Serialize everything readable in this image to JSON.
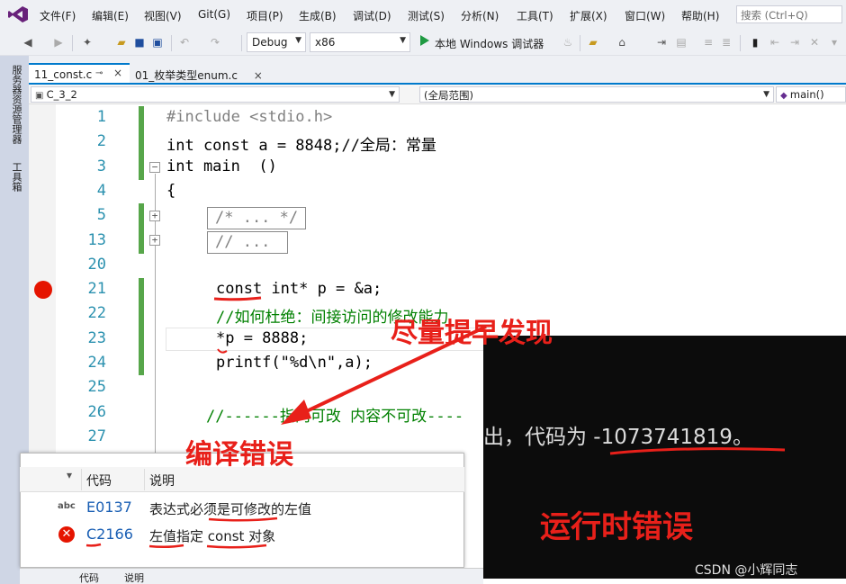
{
  "menu": {
    "items": [
      "文件(F)",
      "编辑(E)",
      "视图(V)",
      "Git(G)",
      "项目(P)",
      "生成(B)",
      "调试(D)",
      "测试(S)",
      "分析(N)",
      "工具(T)",
      "扩展(X)",
      "窗口(W)",
      "帮助(H)"
    ],
    "search_placeholder": "搜索 (Ctrl+Q)"
  },
  "toolbar": {
    "configuration": "Debug",
    "platform": "x86",
    "run_label": "本地 Windows 调试器"
  },
  "side_panel": {
    "tabs": [
      "服务器资源管理器",
      "工具箱"
    ]
  },
  "tabs": [
    {
      "label": "11_const.c",
      "active": true
    },
    {
      "label": "01_枚举类型enum.c",
      "active": false
    }
  ],
  "nav": {
    "project": "C_3_2",
    "scope": "(全局范围)",
    "member": "main()"
  },
  "editor": {
    "lines": [
      {
        "num": "1",
        "text": "#include <stdio.h>"
      },
      {
        "num": "2",
        "text": "int const a = 8848;//全局：常量"
      },
      {
        "num": "3",
        "text": "int main  ()"
      },
      {
        "num": "4",
        "text": "{"
      },
      {
        "num": "5",
        "text": "/* ... */"
      },
      {
        "num": "13",
        "text": "// ..."
      },
      {
        "num": "20",
        "text": ""
      },
      {
        "num": "21",
        "text": "const int* p = &a;"
      },
      {
        "num": "22",
        "text": "//如何杜绝：间接访问的修改能力"
      },
      {
        "num": "23",
        "text": "*p = 8888;"
      },
      {
        "num": "24",
        "text": "printf(\"%d\\n\",a);"
      },
      {
        "num": "25",
        "text": ""
      },
      {
        "num": "26",
        "text": "//------指向可改 内容不可改----"
      },
      {
        "num": "27",
        "text": ""
      }
    ]
  },
  "console": {
    "output_text": "出，代码为 -1073741819。"
  },
  "error_list": {
    "columns": [
      "代码",
      "说明"
    ],
    "rows": [
      {
        "code": "E0137",
        "description": "表达式必须是可修改的左值",
        "icon": "intellisense-error-icon"
      },
      {
        "code": "C2166",
        "description": "左值指定 const 对象",
        "icon": "error-circle-icon"
      }
    ],
    "bottom_columns": [
      "代码",
      "说明"
    ]
  },
  "annotations": {
    "early_detect": "尽量提早发现",
    "compile_error": "编译错误",
    "runtime_error": "运行时错误"
  },
  "watermark": "CSDN @小辉同志",
  "colors": {
    "accent": "#007acc",
    "annotation_red": "#e8201a",
    "breakpoint": "#e51400",
    "keyword": "#0000ff",
    "comment": "#008000",
    "change_bar": "#57a64a"
  }
}
